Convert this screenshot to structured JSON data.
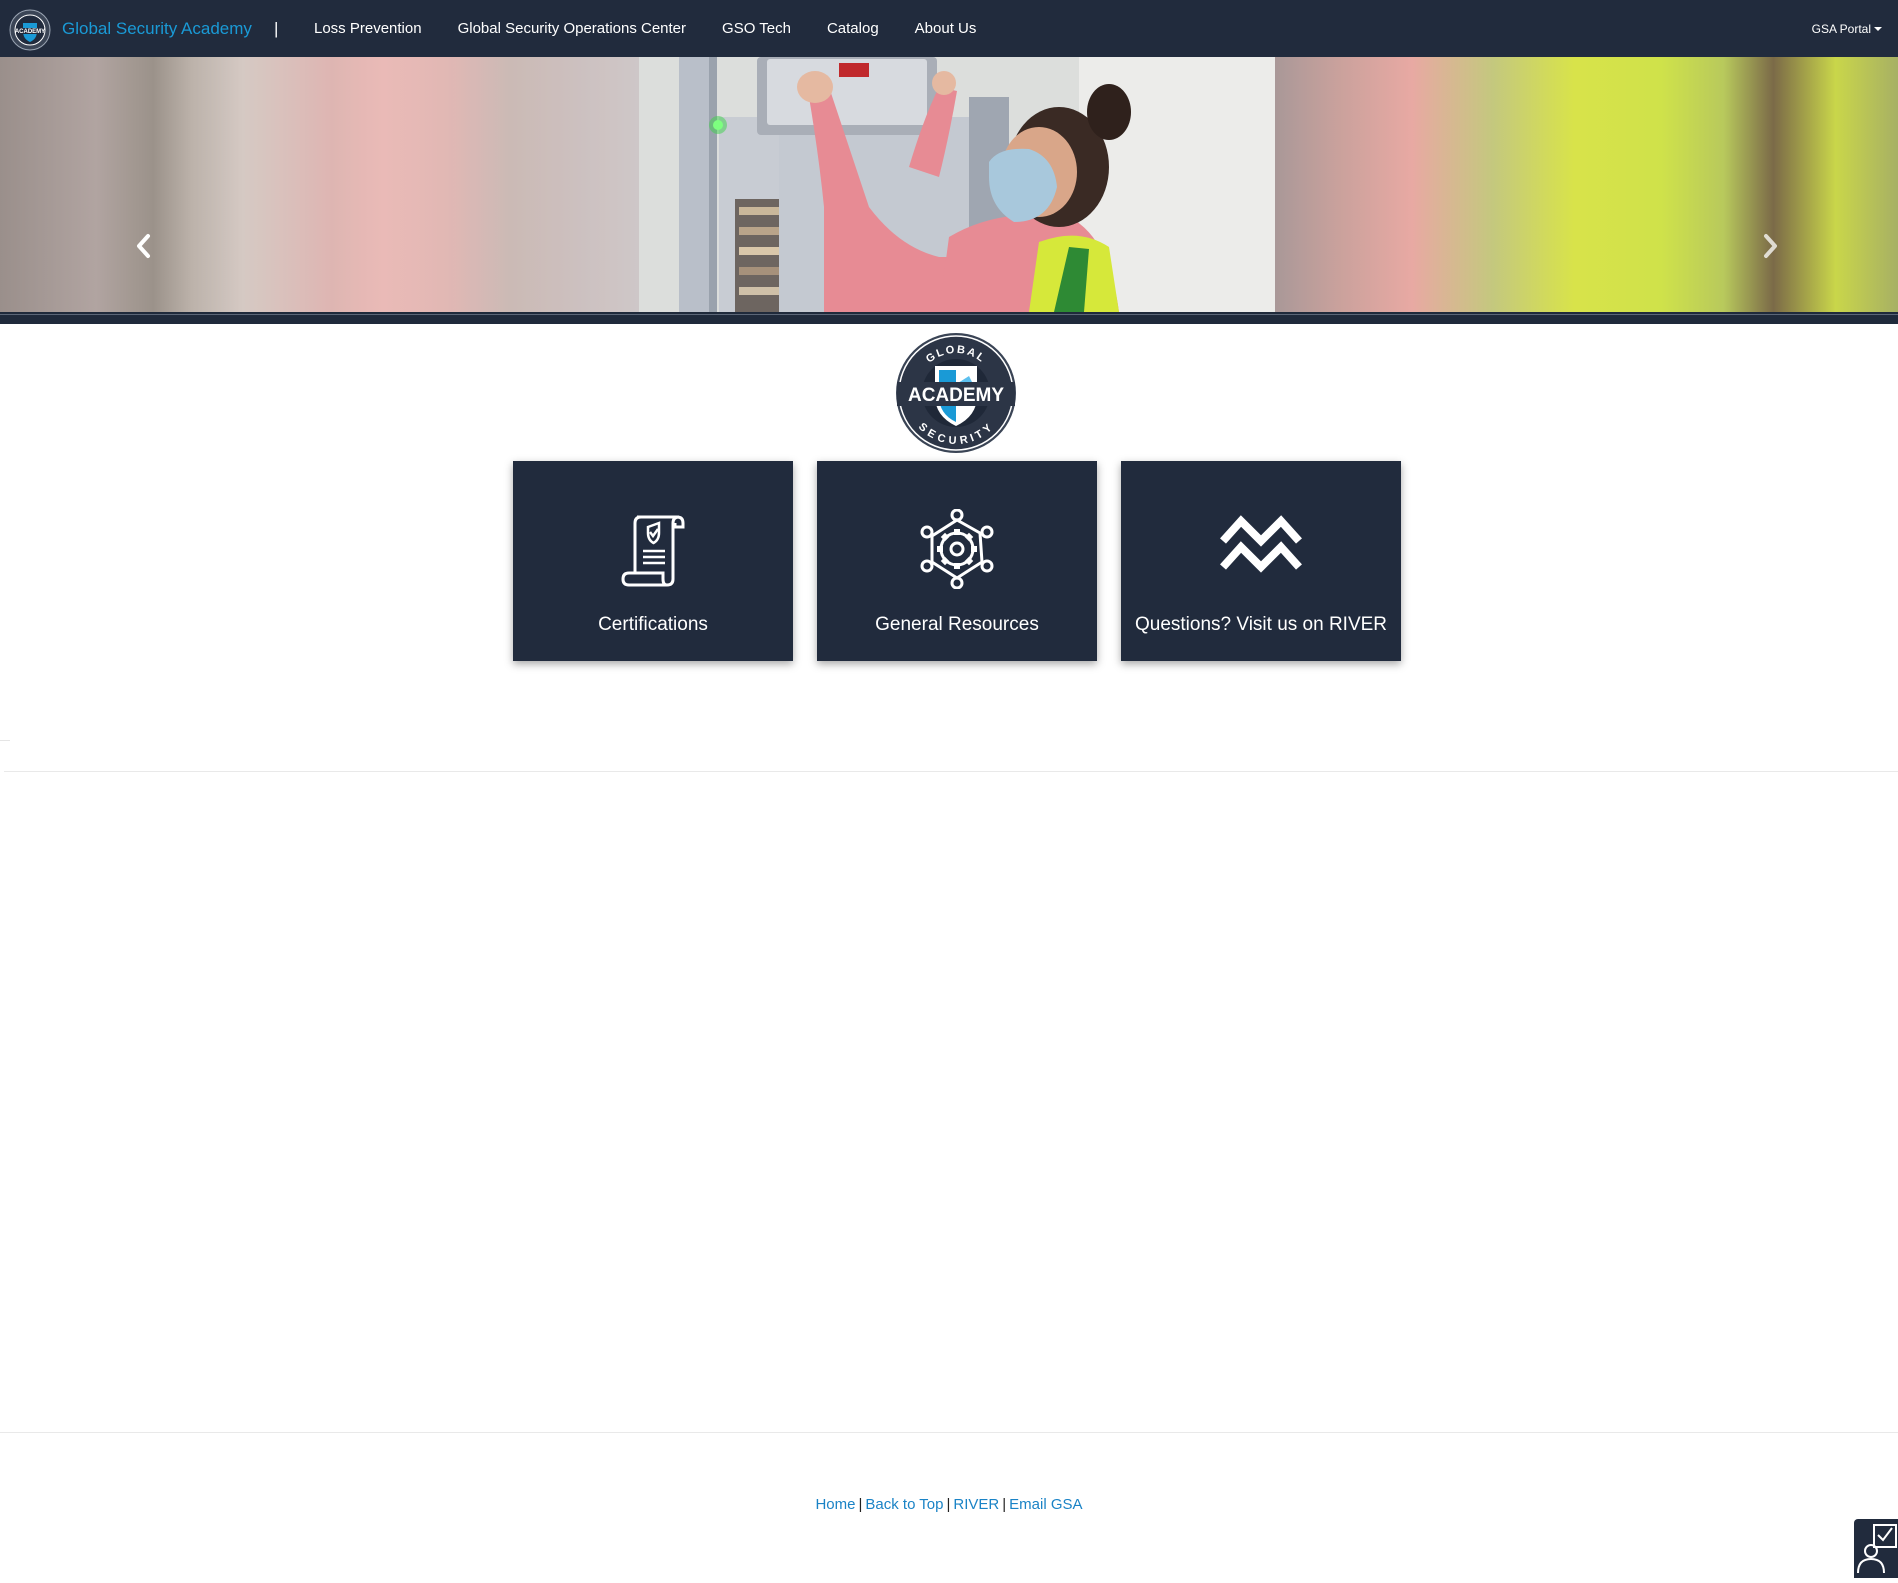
{
  "navbar": {
    "brand_name": "Global Security Academy",
    "separator": "|",
    "links": [
      "Loss Prevention",
      "Global Security Operations Center",
      "GSO Tech",
      "Catalog",
      "About Us"
    ],
    "portal_label": "GSA Portal"
  },
  "logo": {
    "top_text": "GLOBAL",
    "main_text": "ACADEMY",
    "bottom_text": "SECURITY"
  },
  "cards": [
    {
      "label": "Certifications",
      "icon": "certificate-scroll-icon"
    },
    {
      "label": "General Resources",
      "icon": "gear-network-icon"
    },
    {
      "label": "Questions? Visit us on RIVER",
      "icon": "river-waves-icon"
    }
  ],
  "footer": {
    "links": [
      "Home",
      "Back to Top",
      "RIVER",
      "Email GSA"
    ],
    "separator": "|"
  },
  "colors": {
    "navbar_bg": "#212b3d",
    "brand_blue": "#1a9ad6",
    "link_blue": "#1a83c6",
    "card_bg": "#212b3d"
  }
}
